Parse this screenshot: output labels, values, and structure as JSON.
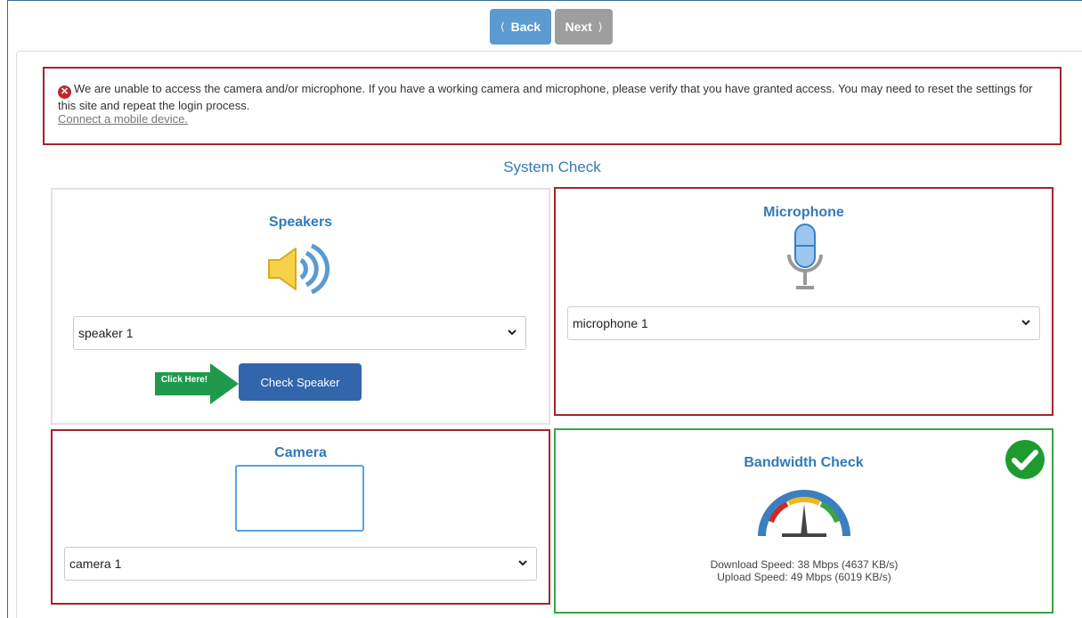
{
  "nav": {
    "back_label": "Back",
    "next_label": "Next"
  },
  "alert": {
    "message": "We are unable to access the camera and/or microphone. If you have a working camera and microphone, please verify that you have granted access. You may need to reset the settings for this site and repeat the login process.",
    "link": "Connect a mobile device.",
    "icon": "error-circle-icon"
  },
  "page": {
    "title": "System Check"
  },
  "speakers": {
    "title": "Speakers",
    "selected": "speaker 1",
    "check_button": "Check Speaker",
    "hint": "Click Here!",
    "status": "neutral"
  },
  "microphone": {
    "title": "Microphone",
    "selected": "microphone 1",
    "status": "error"
  },
  "camera": {
    "title": "Camera",
    "selected": "camera 1",
    "status": "error"
  },
  "bandwidth": {
    "title": "Bandwidth Check",
    "download": "Download Speed: 38 Mbps (4637 KB/s)",
    "upload": "Upload Speed: 49 Mbps (6019 KB/s)",
    "status": "ok"
  },
  "colors": {
    "accent": "#337ab7",
    "error": "#a3242d",
    "success": "#3aa546",
    "primary_button": "#3166ad",
    "hint_arrow": "#1f9a4d"
  }
}
